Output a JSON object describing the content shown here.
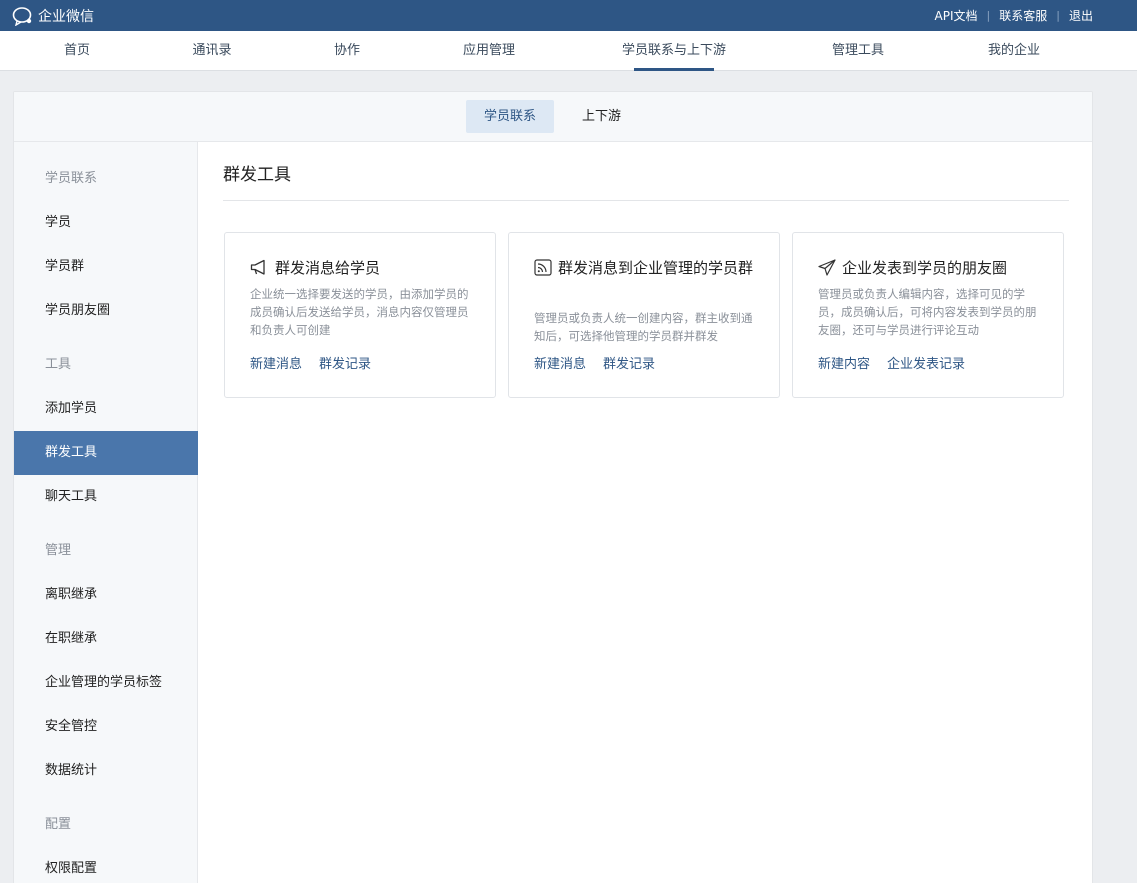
{
  "app": {
    "name": "企业微信"
  },
  "top_links": [
    "API文档",
    "联系客服",
    "退出"
  ],
  "main_nav": [
    {
      "label": "首页",
      "active": false
    },
    {
      "label": "通讯录",
      "active": false
    },
    {
      "label": "协作",
      "active": false
    },
    {
      "label": "应用管理",
      "active": false
    },
    {
      "label": "学员联系与上下游",
      "active": true
    },
    {
      "label": "管理工具",
      "active": false
    },
    {
      "label": "我的企业",
      "active": false
    }
  ],
  "sub_tabs": [
    {
      "label": "学员联系",
      "active": true
    },
    {
      "label": "上下游",
      "active": false
    }
  ],
  "sidebar": {
    "groups": [
      {
        "title": "学员联系",
        "items": [
          "学员",
          "学员群",
          "学员朋友圈"
        ]
      },
      {
        "title": "工具",
        "items": [
          "添加学员",
          "群发工具",
          "聊天工具"
        ]
      },
      {
        "title": "管理",
        "items": [
          "离职继承",
          "在职继承",
          "企业管理的学员标签",
          "安全管控",
          "数据统计"
        ]
      },
      {
        "title": "配置",
        "items": [
          "权限配置"
        ]
      }
    ],
    "active_item": "群发工具"
  },
  "content": {
    "title": "群发工具",
    "cards": [
      {
        "icon": "megaphone-icon",
        "title": "群发消息给学员",
        "description": "企业统一选择要发送的学员，由添加学员的成员确认后发送给学员，消息内容仅管理员和负责人可创建",
        "links": [
          "新建消息",
          "群发记录"
        ]
      },
      {
        "icon": "broadcast-icon",
        "title": "群发消息到企业管理的学员群",
        "description": "管理员或负责人统一创建内容，群主收到通知后，可选择他管理的学员群并群发",
        "links": [
          "新建消息",
          "群发记录"
        ]
      },
      {
        "icon": "paper-plane-icon",
        "title": "企业发表到学员的朋友圈",
        "description": "管理员或负责人编辑内容，选择可见的学员，成员确认后，可将内容发表到学员的朋友圈，还可与学员进行评论互动",
        "links": [
          "新建内容",
          "企业发表记录"
        ]
      }
    ]
  },
  "colors": {
    "topbar": "#2e5685",
    "active_sidebar": "#4a76ab",
    "link": "#2e5685"
  }
}
